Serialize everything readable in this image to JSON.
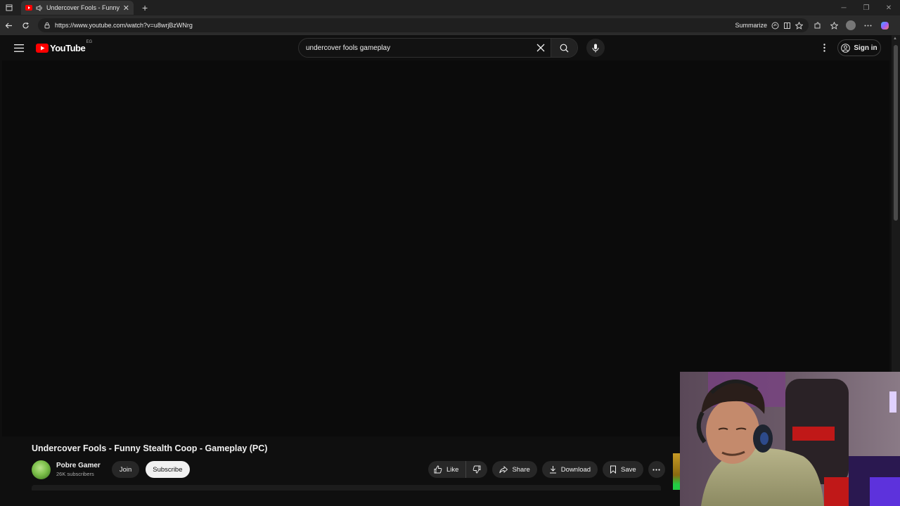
{
  "browser": {
    "tab_title": "Undercover Fools - Funny St",
    "url": "https://www.youtube.com/watch?v=u8wrjBzWNrg",
    "summarize_label": "Summarize"
  },
  "youtube": {
    "logo_text": "YouTube",
    "region": "EG",
    "search_query": "undercover fools gameplay",
    "signin_label": "Sign in"
  },
  "video": {
    "title": "Undercover Fools - Funny Stealth Coop - Gameplay (PC)",
    "channel_name": "Pobre Gamer",
    "subscribers": "26K subscribers",
    "join_label": "Join",
    "subscribe_label": "Subscribe",
    "like_label": "Like",
    "share_label": "Share",
    "download_label": "Download",
    "save_label": "Save"
  },
  "colors": {
    "brand_red": "#ff0000",
    "background": "#0f0f0f",
    "pill": "#272727"
  }
}
